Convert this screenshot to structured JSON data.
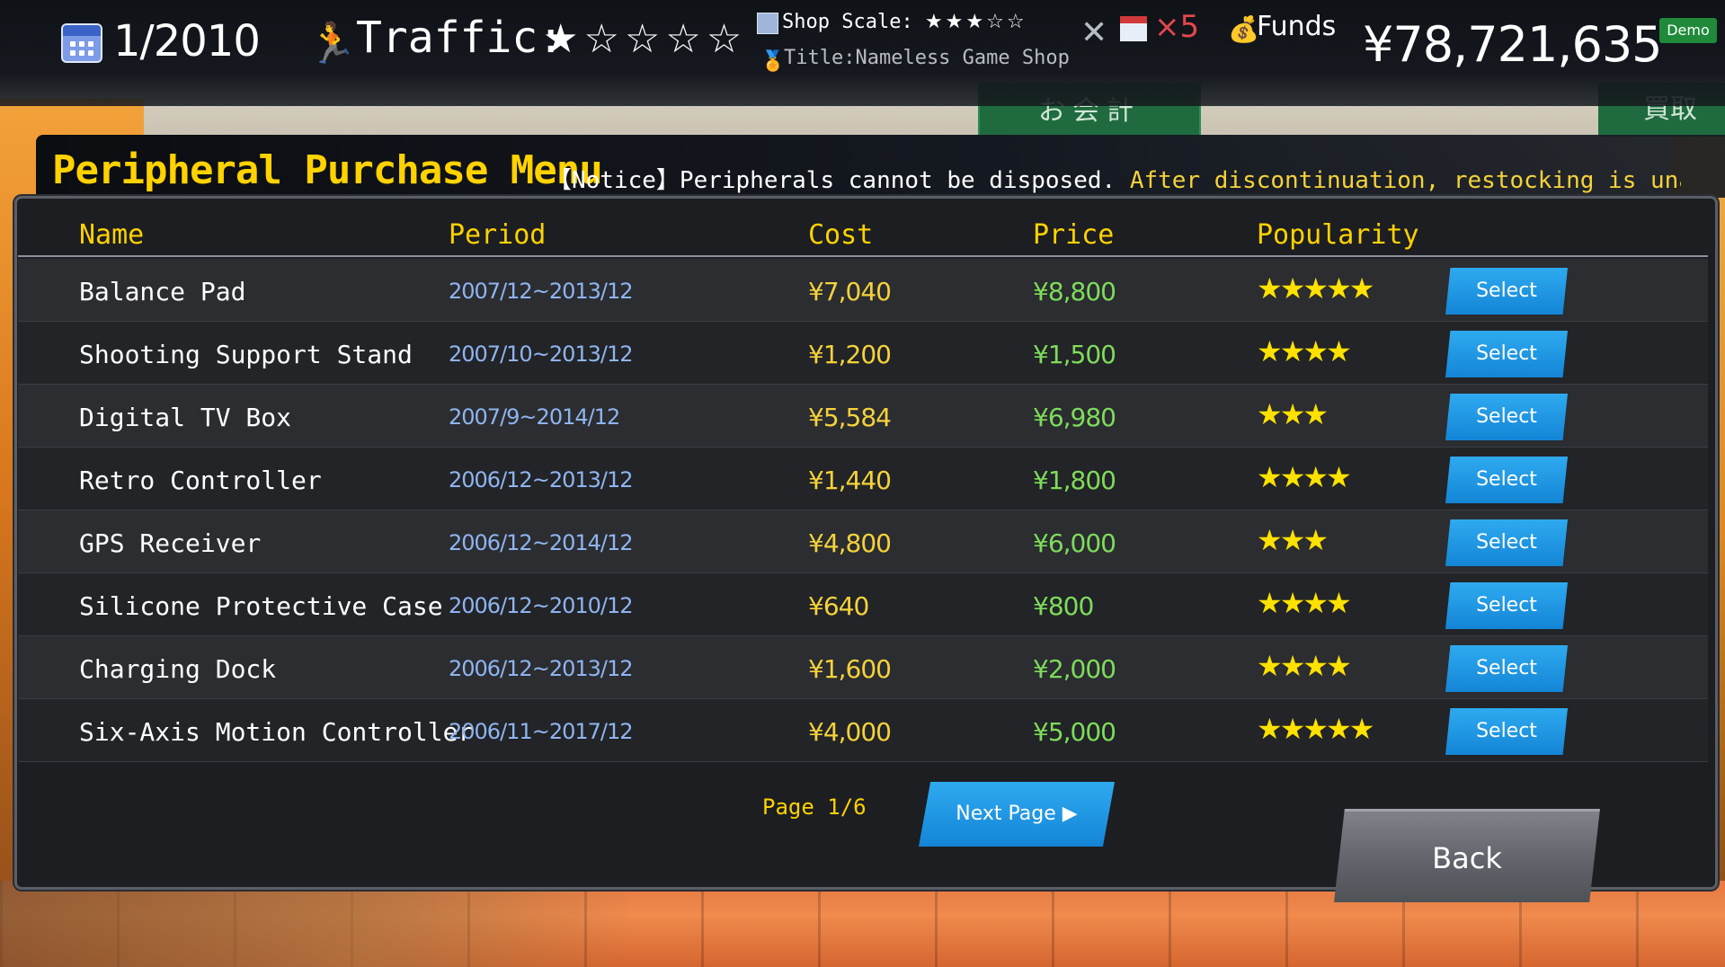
{
  "hud": {
    "date": "1/2010",
    "traffic_label": "Traffic:",
    "traffic_stars": "★☆☆☆☆",
    "shop_scale_label": "Shop Scale:",
    "shop_scale_stars": "★★★☆☆",
    "title_line": "Title:Nameless Game Shop",
    "multiplier": "×5",
    "funds_label": "Funds",
    "funds_value": "¥78,721,635",
    "demo_badge": "Demo"
  },
  "background": {
    "sign_text": "お会計",
    "sign_text2": "買取"
  },
  "menu": {
    "title": "Peripheral Purchase Menu",
    "notice_prefix": "【Notice】Peripherals cannot be disposed.",
    "notice_warn": "After discontinuation, restocking is unavailable."
  },
  "table": {
    "headers": {
      "name": "Name",
      "period": "Period",
      "cost": "Cost",
      "price": "Price",
      "popularity": "Popularity"
    },
    "select_label": "Select",
    "rows": [
      {
        "name": "Balance Pad",
        "period": "2007/12~2013/12",
        "cost": "¥7,040",
        "price": "¥8,800",
        "popularity": "★★★★★"
      },
      {
        "name": "Shooting Support Stand",
        "period": "2007/10~2013/12",
        "cost": "¥1,200",
        "price": "¥1,500",
        "popularity": "★★★★"
      },
      {
        "name": "Digital TV Box",
        "period": "2007/9~2014/12",
        "cost": "¥5,584",
        "price": "¥6,980",
        "popularity": "★★★"
      },
      {
        "name": "Retro Controller",
        "period": "2006/12~2013/12",
        "cost": "¥1,440",
        "price": "¥1,800",
        "popularity": "★★★★"
      },
      {
        "name": "GPS Receiver",
        "period": "2006/12~2014/12",
        "cost": "¥4,800",
        "price": "¥6,000",
        "popularity": "★★★"
      },
      {
        "name": "Silicone Protective Case",
        "period": "2006/12~2010/12",
        "cost": "¥640",
        "price": "¥800",
        "popularity": "★★★★"
      },
      {
        "name": "Charging Dock",
        "period": "2006/12~2013/12",
        "cost": "¥1,600",
        "price": "¥2,000",
        "popularity": "★★★★"
      },
      {
        "name": "Six-Axis Motion Controller",
        "period": "2006/11~2017/12",
        "cost": "¥4,000",
        "price": "¥5,000",
        "popularity": "★★★★★"
      }
    ]
  },
  "footer": {
    "page_label": "Page 1/6",
    "next_label": "Next Page ▶",
    "back_label": "Back"
  },
  "colors": {
    "accent_yellow": "#ffd200",
    "button_blue": "#1e96e4",
    "price_green": "#7edc5a",
    "period_blue": "#8fb4f0",
    "multiplier_red": "#e3474d"
  }
}
